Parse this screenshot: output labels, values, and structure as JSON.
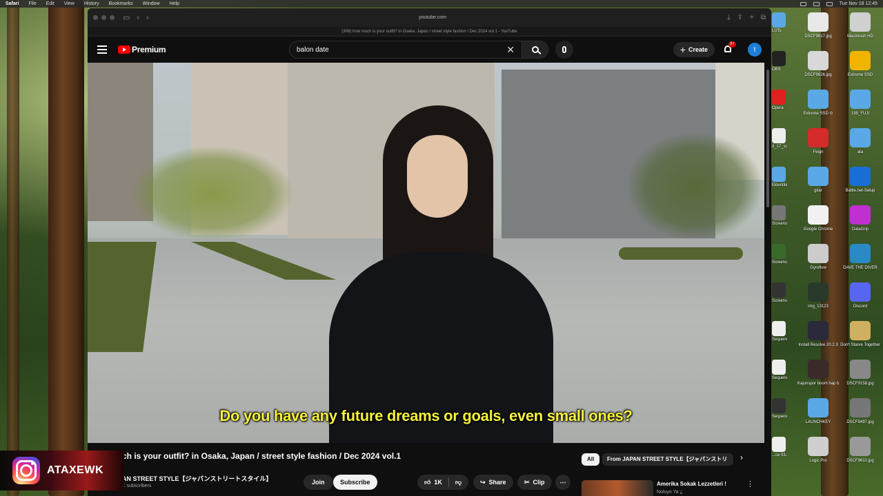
{
  "menubar": {
    "app_name": "Safari",
    "items": [
      "File",
      "Edit",
      "View",
      "History",
      "Bookmarks",
      "Window",
      "Help"
    ],
    "clock": "Tue Nov 18 12:45"
  },
  "browser": {
    "url": "youtube.com",
    "tab_title": "(308) how much is your outfit? in Osaka, Japan / street style fashion / Dec 2024 vol.1 - YouTube"
  },
  "youtube": {
    "logo_text": "Premium",
    "search_value": "balon date",
    "create_label": "Create",
    "notification_count": "9+",
    "avatar_letter": "t"
  },
  "video": {
    "subtitle": "Do you have any future dreams or goals, even small ones?",
    "title": "how much is your outfit? in Osaka, Japan / street style fashion / Dec 2024 vol.1",
    "visible_title": "ch is your outfit? in Osaka, Japan / street style fashion / Dec 2024 vol.1",
    "channel": "AN STREET STYLE【ジャパンストリートスタイル】",
    "subscribers": "K subscribers",
    "join_label": "Join",
    "subscribe_label": "Subscribe",
    "likes": "1K",
    "share_label": "Share",
    "clip_label": "Clip"
  },
  "sidebar": {
    "chip_all": "All",
    "chip_channel": "From JAPAN STREET STYLE【ジャパンストリ",
    "rec_title": "Amerika Sokak Lezzetleri !",
    "rec_channel": "Noluyo Ya ¿"
  },
  "overlay": {
    "handle": "ATAXEWK"
  },
  "desktop": {
    "col1": [
      {
        "label": "DSCF9617.jpg",
        "color": "#e8e8e8"
      },
      {
        "label": "DSCF9626.jpg",
        "color": "#d8d8d8"
      },
      {
        "label": "Extreme SSD ⊙",
        "color": "#5aa9e6"
      },
      {
        "label": "Feign",
        "color": "#d42a2a"
      },
      {
        "label": "gitar",
        "color": "#5aa9e6"
      },
      {
        "label": "Google Chrome",
        "color": "#f1f1f1"
      },
      {
        "label": "Gyroflow",
        "color": "#cccccc"
      },
      {
        "label": "img_13123",
        "color": "#2a3a2a"
      },
      {
        "label": "Install Resolve 20.2.3",
        "color": "#2a2a3a"
      },
      {
        "label": "Kajunspor boom bap beat.mp4",
        "color": "#3a2a2a"
      },
      {
        "label": "LAUNCHKEY",
        "color": "#5aa9e6"
      },
      {
        "label": "Logic Pro",
        "color": "#cfcfcf"
      }
    ],
    "col2": [
      {
        "label": "Macintosh HD",
        "color": "#d0d0d0"
      },
      {
        "label": "Extreme SSD",
        "color": "#f0b400"
      },
      {
        "label": "195_FUJI",
        "color": "#5aa9e6"
      },
      {
        "label": "ata",
        "color": "#5aa9e6"
      },
      {
        "label": "Battle.net-Setup",
        "color": "#1a6fd6"
      },
      {
        "label": "DataGrip",
        "color": "#c030d0"
      },
      {
        "label": "DAVE THE DIVER",
        "color": "#2a8ac6"
      },
      {
        "label": "Discord",
        "color": "#5865f2"
      },
      {
        "label": "Don't Starve Together",
        "color": "#d0b060"
      },
      {
        "label": "DSCF9158.jpg",
        "color": "#888888"
      },
      {
        "label": "DSCF9497.jpg",
        "color": "#777777"
      },
      {
        "label": "DSCF9610.jpg",
        "color": "#999999"
      }
    ],
    "strip": [
      {
        "label": "LUTs",
        "color": "#5aa9e6"
      },
      {
        "label": "OBS",
        "color": "#222222"
      },
      {
        "label": "Opera",
        "color": "#e02020"
      },
      {
        "label": "d_17_songs...dm.wav",
        "color": "#eeeeee"
      },
      {
        "label": "Eklentiler",
        "color": "#5aa9e6"
      },
      {
        "label": "Screenshot ...22.37.09",
        "color": "#777777"
      },
      {
        "label": "Screenshot ...06.56.42",
        "color": "#3a6a2a"
      },
      {
        "label": "Screenshot ...14.47.54",
        "color": "#333333"
      },
      {
        "label": "Sequence ...002.dpx",
        "color": "#eeeeee"
      },
      {
        "label": "Sequence ...dpx.xmp",
        "color": "#eeeeee"
      },
      {
        "label": "Sequence ...003.dpx",
        "color": "#333333"
      },
      {
        "label": "...ce 03.mp3",
        "color": "#eeeeee"
      }
    ]
  }
}
